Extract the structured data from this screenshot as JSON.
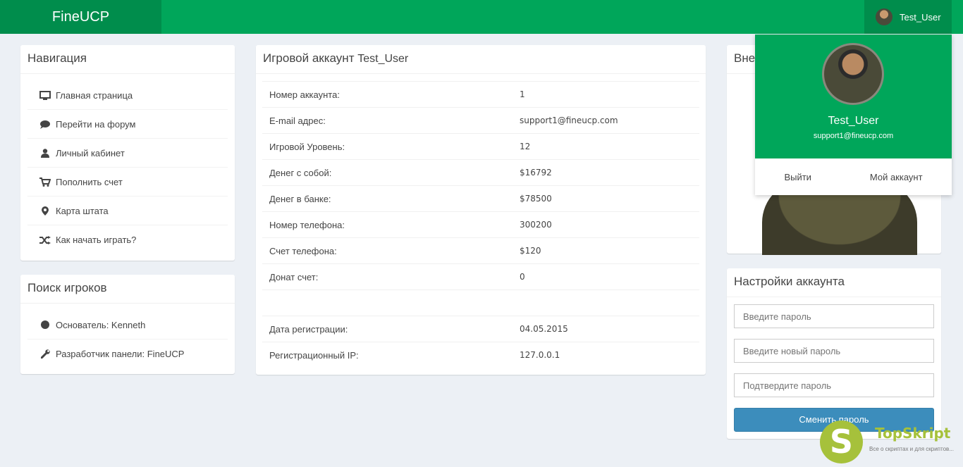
{
  "header": {
    "logo": "FineUCP",
    "username": "Test_User"
  },
  "navigation": {
    "title": "Навигация",
    "items": [
      {
        "label": "Главная страница",
        "icon": "monitor-icon"
      },
      {
        "label": "Перейти на форум",
        "icon": "comment-icon"
      },
      {
        "label": "Личный кабинет",
        "icon": "user-icon"
      },
      {
        "label": "Пополнить счет",
        "icon": "cart-icon"
      },
      {
        "label": "Карта штата",
        "icon": "map-marker-icon"
      },
      {
        "label": "Как начать играть?",
        "icon": "shuffle-icon"
      }
    ]
  },
  "player_search": {
    "title": "Поиск игроков",
    "items": [
      {
        "label": "Основатель: Kenneth",
        "icon": "circle-icon"
      },
      {
        "label": "Разработчик панели: FineUCP",
        "icon": "wrench-icon"
      }
    ]
  },
  "account": {
    "title_prefix": "Игровой аккаунт",
    "title_user": "Test_User",
    "rows": [
      {
        "label": "Номер аккаунта:",
        "value": "1"
      },
      {
        "label": "E-mail адрес:",
        "value": "support1@fineucp.com"
      },
      {
        "label": "Игровой Уровень:",
        "value": "12"
      },
      {
        "label": "Денег с собой:",
        "value": "$16792"
      },
      {
        "label": "Денег в банке:",
        "value": "$78500"
      },
      {
        "label": "Номер телефона:",
        "value": "300200"
      },
      {
        "label": "Счет телефона:",
        "value": "$120"
      },
      {
        "label": "Донат счет:",
        "value": "0"
      },
      {
        "label": "",
        "value": ""
      },
      {
        "label": "Дата регистрации:",
        "value": "04.05.2015"
      },
      {
        "label": "Регистрационный IP:",
        "value": "127.0.0.1"
      }
    ]
  },
  "appearance": {
    "title_visible": "Вне"
  },
  "user_dropdown": {
    "name": "Test_User",
    "email": "support1@fineucp.com",
    "logout": "Выйти",
    "my_account": "Мой аккаунт"
  },
  "settings": {
    "title": "Настройки аккаунта",
    "password_placeholder": "Введите пароль",
    "new_password_placeholder": "Введите новый пароль",
    "confirm_password_placeholder": "Подтвердите пароль",
    "submit": "Сменить пароль"
  },
  "watermark": {
    "letter": "S",
    "brand": "TopSkript",
    "slogan": "Все о скриптах и для скриптов..."
  },
  "colors": {
    "header": "#00a65a",
    "header_dark": "#008d4c",
    "button": "#3c8dbc",
    "background": "#ecf0f5"
  }
}
